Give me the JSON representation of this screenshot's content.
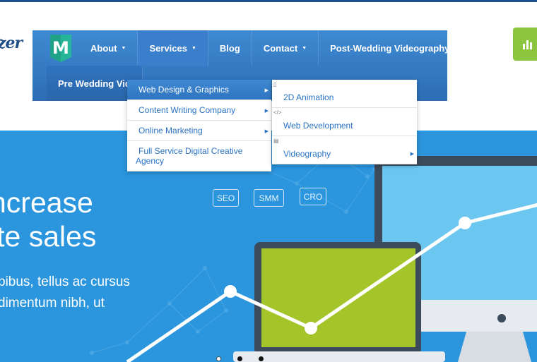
{
  "brand": {
    "logo_text": "zer",
    "badge_letter": "M"
  },
  "colors": {
    "nav_blue": "#2c6db5",
    "hero_blue": "#2b95dd",
    "accent_green": "#8cc63e",
    "screen_green": "#a3c52a"
  },
  "nav": {
    "items": [
      {
        "label": "About",
        "has_caret": true
      },
      {
        "label": "Services",
        "has_caret": true,
        "active": true
      },
      {
        "label": "Blog"
      },
      {
        "label": "Contact",
        "has_caret": true
      },
      {
        "label": "Post-Wedding Videography"
      }
    ],
    "row2": {
      "label": "Pre Wedding Vid"
    }
  },
  "dropdown": {
    "items": [
      {
        "label": "Web Design & Graphics",
        "highlighted": true
      },
      {
        "label": "Content Writing Company"
      },
      {
        "label": "Online Marketing"
      },
      {
        "label": "Full Service Digital Creative Agency"
      }
    ],
    "submenu": [
      {
        "label": "2D Animation",
        "icon": "doc-icon"
      },
      {
        "label": "Web Development",
        "icon": "code-icon"
      },
      {
        "label": "Videography",
        "icon": "briefcase-icon"
      }
    ]
  },
  "hero": {
    "headline_line1": "ncrease",
    "headline_line2": "ite sales",
    "body_line1": "pibus, tellus ac cursus",
    "body_line2": "dimentum nibh, ut",
    "tags": [
      "SEO",
      "SMM",
      "CRO"
    ],
    "slides_total": 3,
    "slide_active": 1
  },
  "cta": {
    "icon": "chart-bars-icon"
  }
}
